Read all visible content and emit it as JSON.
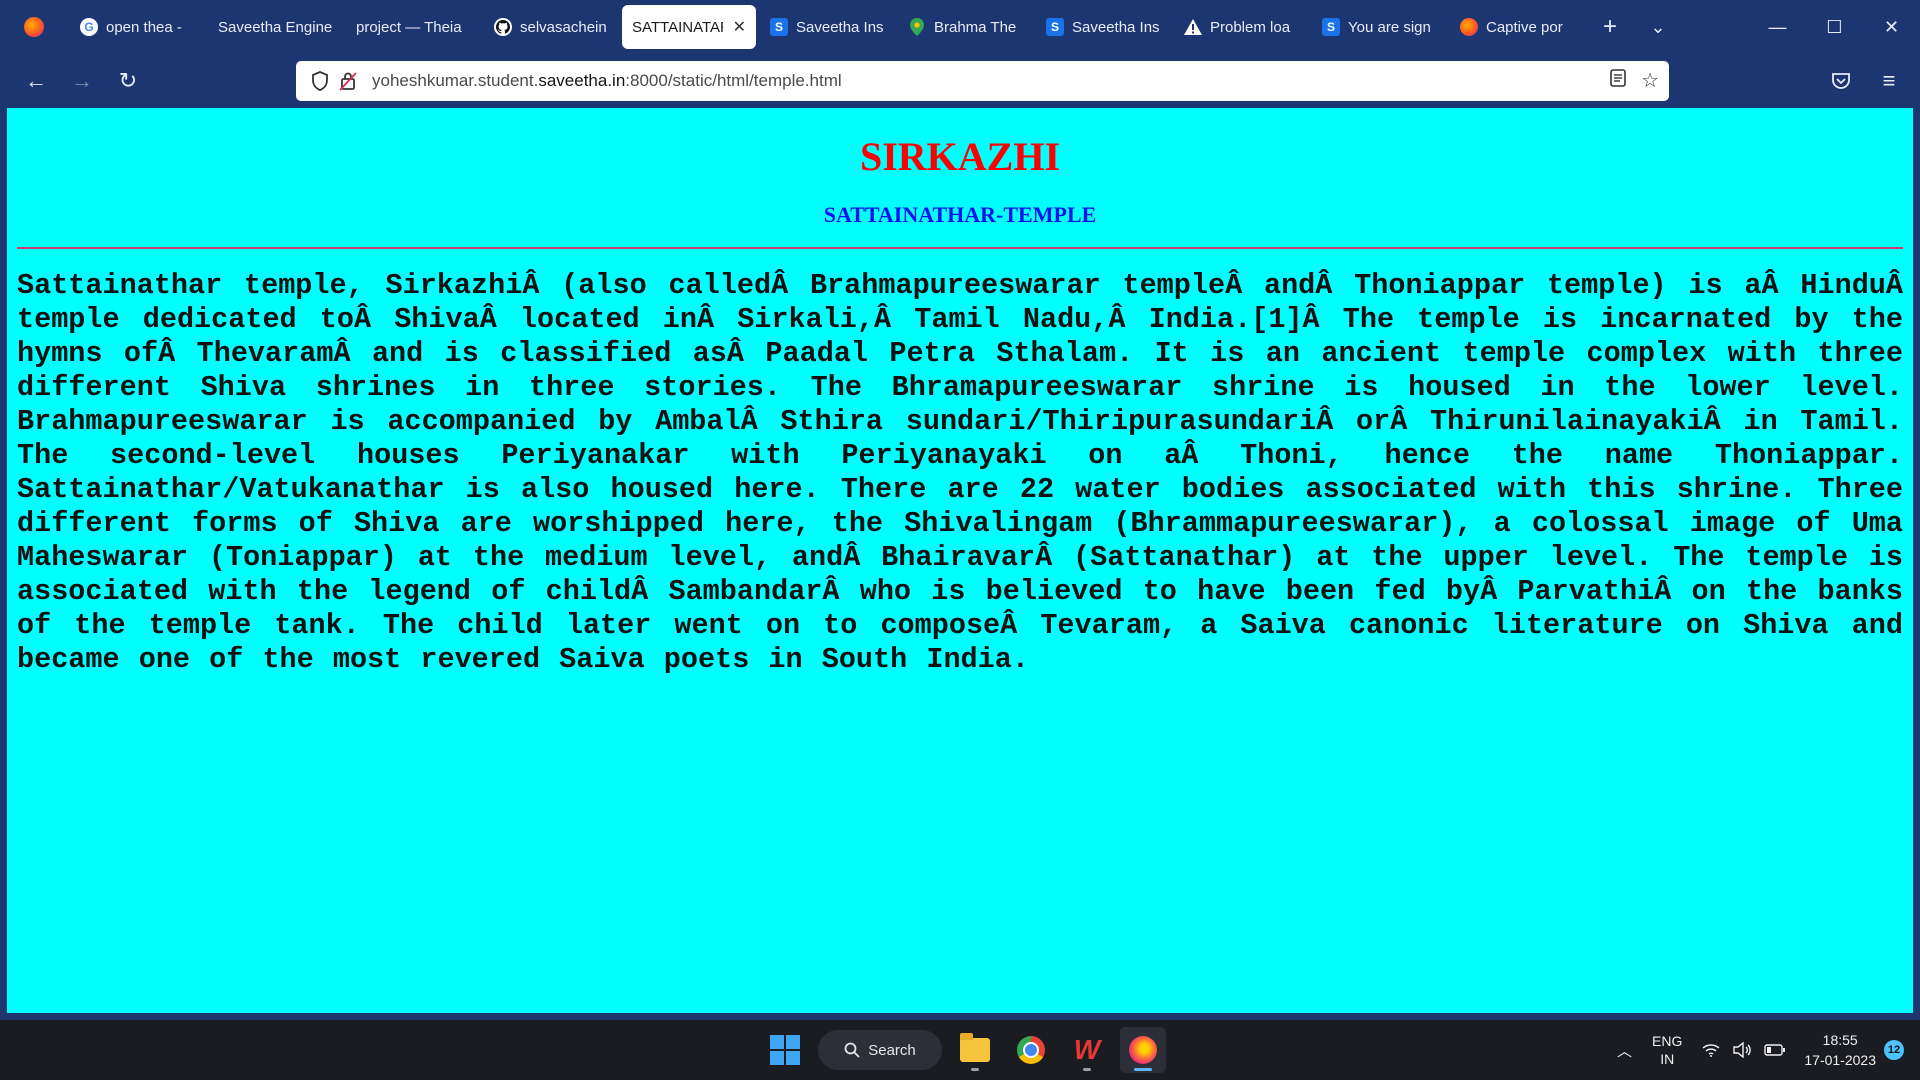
{
  "browser": {
    "tabs": [
      {
        "title": "open thea -",
        "favicon": "google-icon",
        "active": false
      },
      {
        "title": "Saveetha Engine",
        "favicon": "none",
        "active": false
      },
      {
        "title": "project — Theia",
        "favicon": "none",
        "active": false
      },
      {
        "title": "selvasachein",
        "favicon": "github-icon",
        "active": false
      },
      {
        "title": "SATTAINATAR",
        "favicon": "none",
        "active": true
      },
      {
        "title": "Saveetha Ins",
        "favicon": "saveetha-icon",
        "active": false
      },
      {
        "title": "Brahma The",
        "favicon": "map-pin-icon",
        "active": false
      },
      {
        "title": "Saveetha Ins",
        "favicon": "saveetha-icon",
        "active": false
      },
      {
        "title": "Problem loa",
        "favicon": "warning-icon",
        "active": false
      },
      {
        "title": "You are sign",
        "favicon": "saveetha-icon",
        "active": false
      },
      {
        "title": "Captive por",
        "favicon": "firefox-icon",
        "active": false
      }
    ],
    "url": {
      "prefix": "yoheshkumar.student.",
      "host": "saveetha.in",
      "suffix": ":8000/static/html/temple.html"
    }
  },
  "page": {
    "title": "SIRKAZHI",
    "subtitle": "SATTAINATHAR-TEMPLE",
    "body": "Sattainathar temple, SirkazhiÂ (also calledÂ Brahmapureeswarar templeÂ andÂ Thoniappar temple) is aÂ HinduÂ temple dedicated toÂ ShivaÂ located inÂ Sirkali,Â Tamil Nadu,Â India.[1]Â The temple is incarnated by the hymns ofÂ ThevaramÂ and is classified asÂ Paadal Petra Sthalam. It is an ancient temple complex with three different Shiva shrines in three stories. The Bhramapureeswarar shrine is housed in the lower level. Brahmapureeswarar is accompanied by AmbalÂ Sthira sundari/ThiripurasundariÂ orÂ ThirunilainayakiÂ in Tamil. The second-level houses Periyanakar with Periyanayaki on aÂ Thoni, hence the name Thoniappar. Sattainathar/Vatukanathar is also housed here. There are 22 water bodies associated with this shrine. Three different forms of Shiva are worshipped here, the Shivalingam (Bhrammapureeswarar), a colossal image of Uma Maheswarar (Toniappar) at the medium level, andÂ BhairavarÂ (Sattanathar) at the upper level. The temple is associated with the legend of childÂ SambandarÂ who is believed to have been fed byÂ ParvathiÂ on the banks of the temple tank. The child later went on to composeÂ Tevaram, a Saiva canonic literature on Shiva and became one of the most revered Saiva poets in South India.",
    "colors": {
      "background": "#00ffff",
      "title": "#ff0000",
      "subtitle": "#1010ee",
      "rule": "#d33a6b"
    }
  },
  "taskbar": {
    "search_label": "Search",
    "lang_top": "ENG",
    "lang_bottom": "IN",
    "time": "18:55",
    "date": "17-01-2023",
    "notifications": "12"
  }
}
